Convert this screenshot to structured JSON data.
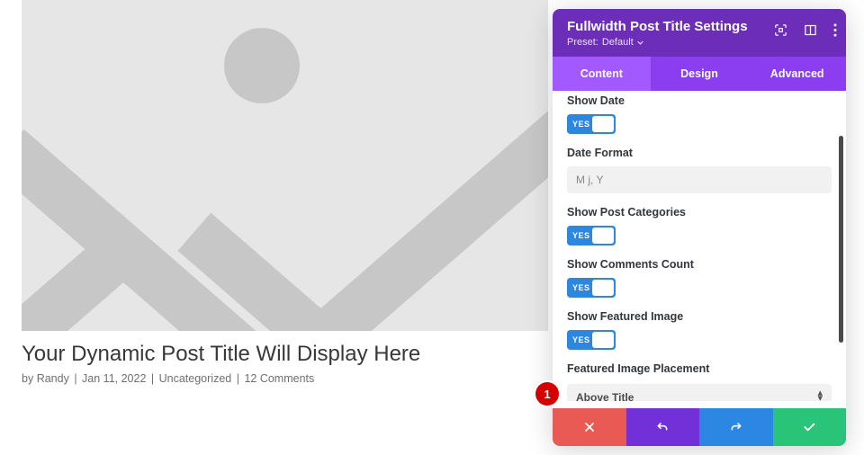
{
  "preview": {
    "title": "Your Dynamic Post Title Will Display Here",
    "by": "by",
    "author": "Randy",
    "date": "Jan 11, 2022",
    "category": "Uncategorized",
    "comments": "12 Comments"
  },
  "panel": {
    "title": "Fullwidth Post Title Settings",
    "preset_label": "Preset:",
    "preset_value": "Default",
    "tabs": {
      "content": "Content",
      "design": "Design",
      "advanced": "Advanced"
    },
    "fields": {
      "show_date": "Show Date",
      "date_format": "Date Format",
      "date_format_value": "M j, Y",
      "show_categories": "Show Post Categories",
      "show_comments": "Show Comments Count",
      "show_featured": "Show Featured Image",
      "featured_placement": "Featured Image Placement",
      "featured_placement_value": "Above Title",
      "yes": "YES"
    }
  },
  "badge": {
    "num": "1"
  }
}
